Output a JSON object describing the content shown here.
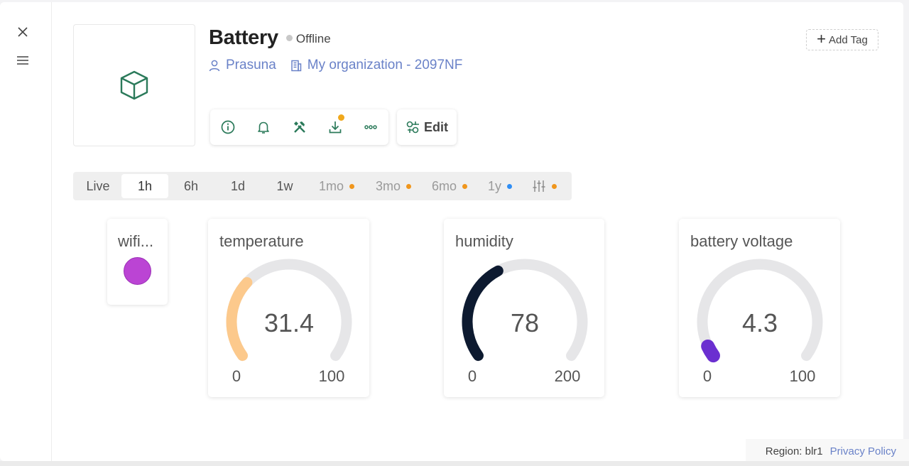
{
  "device": {
    "title": "Battery",
    "status": "Offline",
    "owner": "Prasuna",
    "organization": "My organization - 2097NF",
    "add_tag_label": "Add Tag",
    "edit_label": "Edit"
  },
  "toolbar": {
    "items": [
      {
        "name": "info-icon"
      },
      {
        "name": "bell-icon"
      },
      {
        "name": "tools-icon"
      },
      {
        "name": "download-icon",
        "badge_color": "#f0a81c"
      },
      {
        "name": "more-icon"
      }
    ]
  },
  "time_ranges": [
    {
      "label": "Live",
      "state": "normal"
    },
    {
      "label": "1h",
      "state": "active"
    },
    {
      "label": "6h",
      "state": "normal"
    },
    {
      "label": "1d",
      "state": "normal"
    },
    {
      "label": "1w",
      "state": "normal"
    },
    {
      "label": "1mo",
      "state": "dim",
      "dot_color": "#f0961c"
    },
    {
      "label": "3mo",
      "state": "dim",
      "dot_color": "#f0961c"
    },
    {
      "label": "6mo",
      "state": "dim",
      "dot_color": "#f0961c"
    },
    {
      "label": "1y",
      "state": "dim",
      "dot_color": "#2f8ef5"
    },
    {
      "label": "",
      "state": "dim",
      "icon": "sliders-icon",
      "dot_color": "#f0961c"
    }
  ],
  "widgets": {
    "wifi": {
      "label": "wifi...",
      "indicator_color": "#bb44d4"
    },
    "gauges": [
      {
        "label": "temperature",
        "value": "31.4",
        "min": "0",
        "max": "100",
        "fraction": 0.314,
        "color": "#fcc98c"
      },
      {
        "label": "humidity",
        "value": "78",
        "min": "0",
        "max": "200",
        "fraction": 0.39,
        "color": "#0d1a30"
      },
      {
        "label": "battery voltage",
        "value": "4.3",
        "min": "0",
        "max": "100",
        "fraction": 0.043,
        "color": "#6b2fd0"
      }
    ]
  },
  "colors": {
    "accent_green": "#2b7a5a",
    "link_blue": "#6a82c8",
    "gauge_track": "#e6e6e8"
  },
  "footer": {
    "region": "Region: blr1",
    "privacy": "Privacy Policy"
  }
}
